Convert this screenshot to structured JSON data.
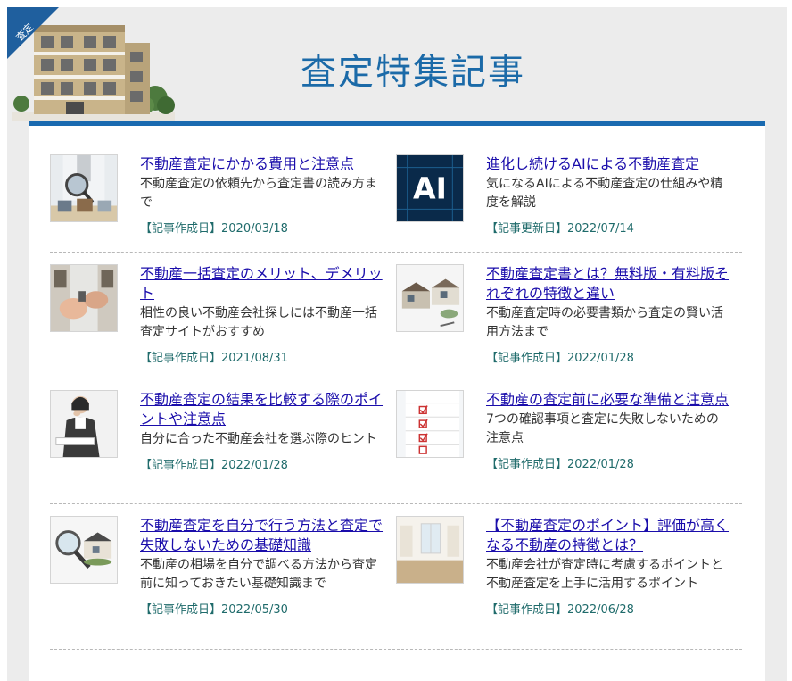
{
  "header": {
    "ribbon_label": "査定",
    "title": "査定特集記事"
  },
  "articles": [
    {
      "title": "不動産査定にかかる費用と注意点",
      "desc": "不動産査定の依頼先から査定書の読み方まで",
      "date": "【記事作成日】2020/03/18",
      "thumb_icon": "inspector-magnifier-icon"
    },
    {
      "title": "進化し続けるAIによる不動産査定",
      "desc": "気になるAIによる不動産査定の仕組みや精度を解説",
      "date": "【記事更新日】2022/07/14",
      "thumb_icon": "ai-chip-icon",
      "thumb_text": "AI"
    },
    {
      "title": "不動産一括査定のメリット、デメリット",
      "desc": "相性の良い不動産会社探しには不動産一括査定サイトがおすすめ",
      "date": "【記事作成日】2021/08/31",
      "thumb_icon": "handshake-icon"
    },
    {
      "title": "不動産査定書とは？無料版・有料版それぞれの特徴と違い",
      "desc": "不動産査定時の必要書類から査定の賢い活用方法まで",
      "date": "【記事作成日】2022/01/28",
      "thumb_icon": "house-models-icon"
    },
    {
      "title": "不動産査定の結果を比較する際のポイントや注意点",
      "desc": "自分に合った不動産会社を選ぶ際のヒント",
      "date": "【記事作成日】2022/01/28",
      "thumb_icon": "businesswoman-document-icon"
    },
    {
      "title": "不動産の査定前に必要な準備と注意点",
      "desc": "7つの確認事項と査定に失敗しないための注意点",
      "date": "【記事作成日】2022/01/28",
      "thumb_icon": "checklist-icon"
    },
    {
      "title": "不動産査定を自分で行う方法と査定で失敗しないための基礎知識",
      "desc": "不動産の相場を自分で調べる方法から査定前に知っておきたい基礎知識まで",
      "date": "【記事作成日】2022/05/30",
      "thumb_icon": "magnifier-house-icon"
    },
    {
      "title": "【不動産査定のポイント】評価が高くなる不動産の特徴とは？",
      "desc": "不動産会社が査定時に考慮するポイントと不動産査定を上手に活用するポイント",
      "date": "【記事作成日】2022/06/28",
      "thumb_icon": "empty-room-icon"
    }
  ]
}
